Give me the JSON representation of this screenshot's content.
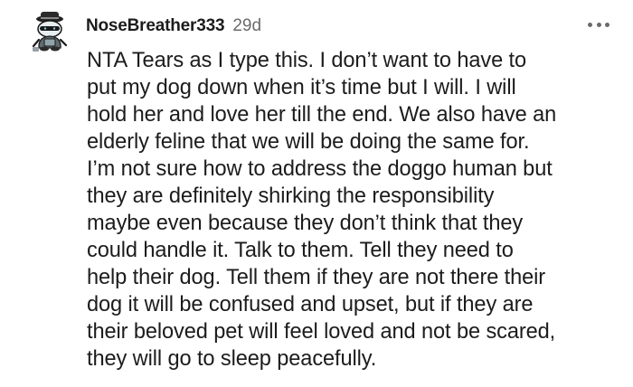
{
  "comment": {
    "author": "NoseBreather333",
    "age": "29d",
    "avatar_icon": "snoo-avatar-icon",
    "overflow_icon": "more-options-icon",
    "body_lines": [
      "NTA Tears as I type this. I don’t want to have to",
      "put my dog down when it’s time but I will. I will",
      "hold her and love her till the end. We also have an",
      "elderly feline that we will be doing the same for.",
      "I’m not sure how to address the doggo human but",
      "they are definitely shirking the responsibility",
      "maybe even because they don’t think that they",
      "could handle it. Talk to them. Tell they need to",
      "help their dog. Tell them if they are not there their",
      "dog it will be confused and upset, but if they are",
      "their beloved pet will feel loved and not be scared,",
      "they will go to sleep peacefully."
    ]
  }
}
